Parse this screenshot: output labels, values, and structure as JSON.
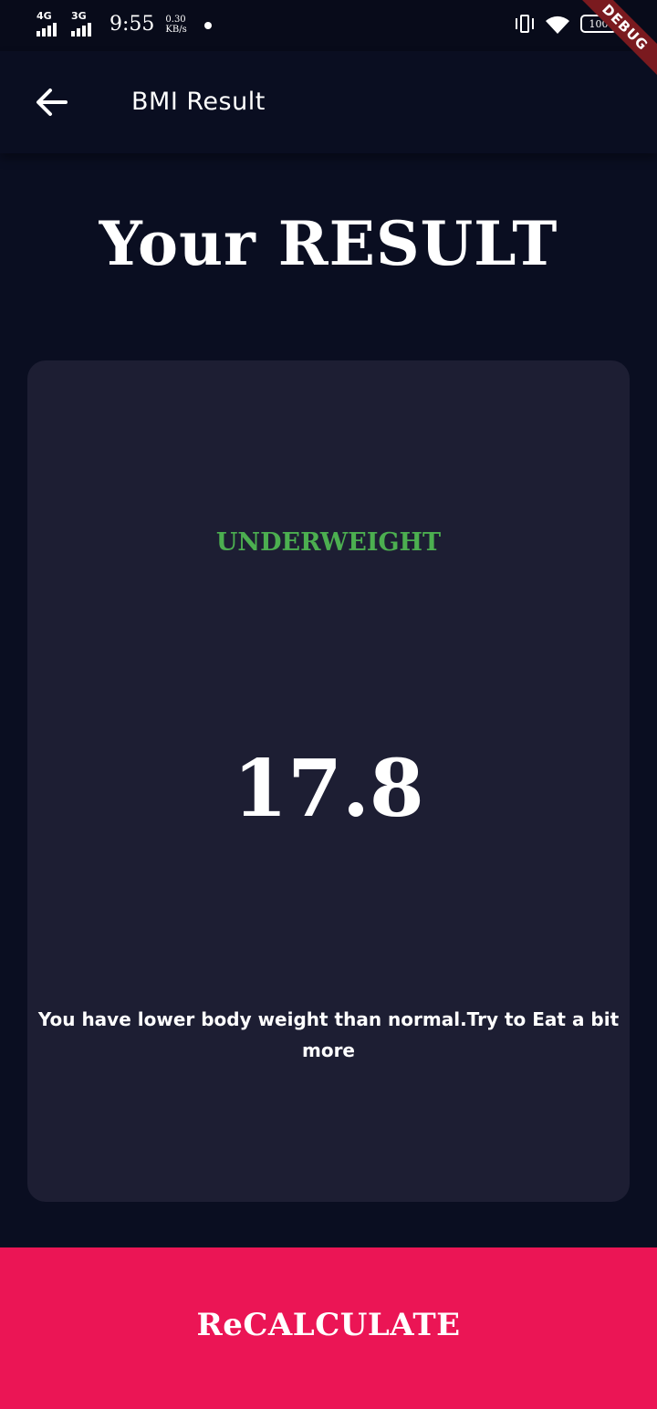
{
  "status_bar": {
    "network_1": "4G",
    "network_2": "3G",
    "time": "9:55",
    "speed_value": "0.30",
    "speed_unit": "KB/s",
    "battery": "100"
  },
  "debug_banner": "DEBUG",
  "app_bar": {
    "back_icon": "arrow-back-icon",
    "title": "BMI Result"
  },
  "heading": "Your RESULT",
  "result": {
    "status": "UNDERWEIGHT",
    "status_color": "#4caf50",
    "bmi": "17.8",
    "advice": "You have lower body weight than normal.Try to Eat a bit more"
  },
  "recalculate_button": {
    "label": "ReCALCULATE",
    "color": "#eb1555"
  },
  "colors": {
    "background": "#0a0e21",
    "card": "#1d1e33"
  }
}
